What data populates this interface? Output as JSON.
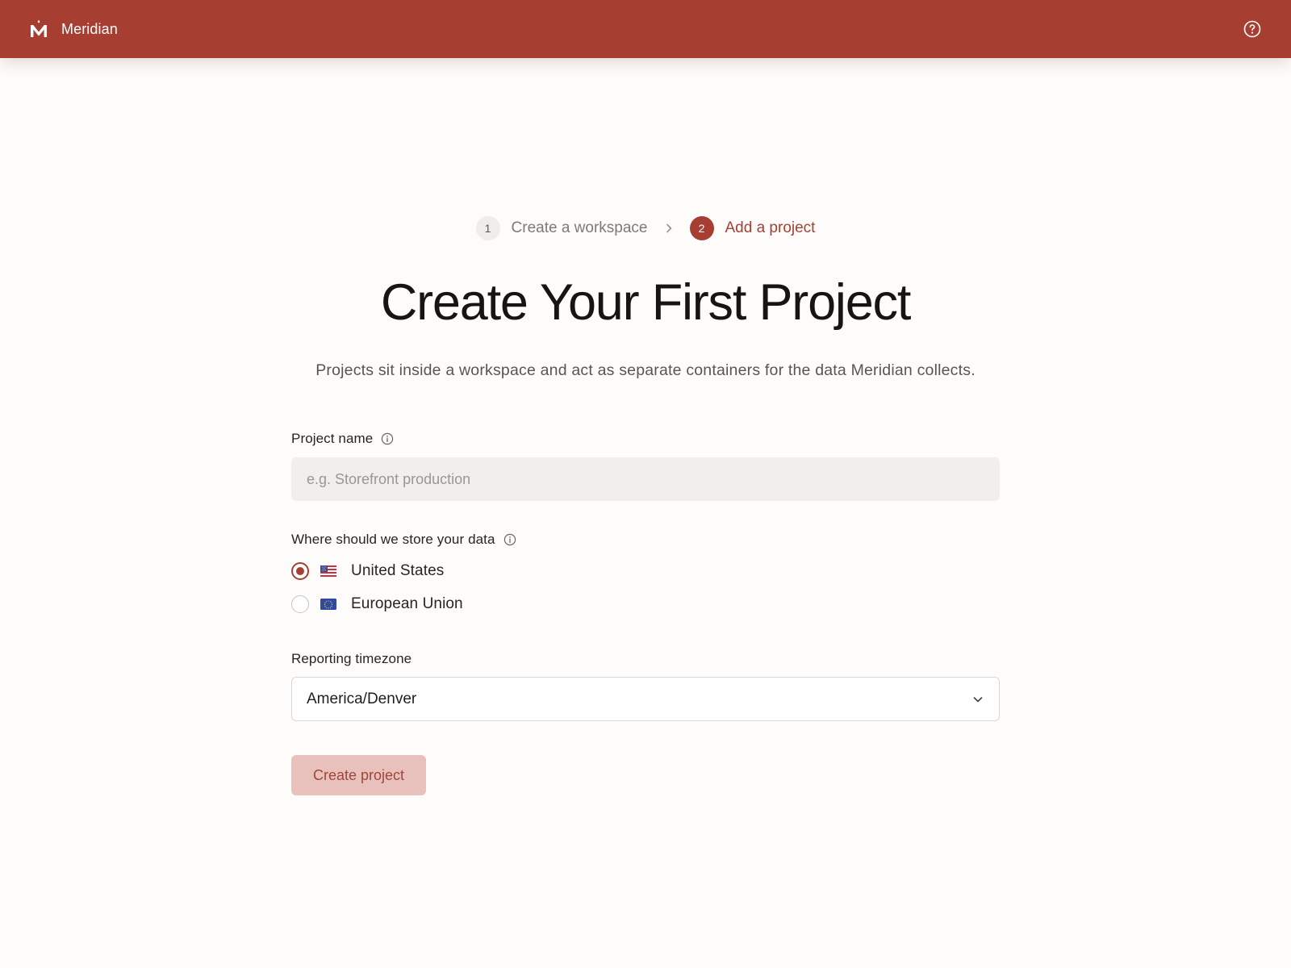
{
  "header": {
    "brand_name": "Meridian",
    "logo_icon": "meridian-logo-icon",
    "help_icon": "help-circle-icon",
    "background_color": "#a63f32"
  },
  "stepper": {
    "steps": [
      {
        "number": "1",
        "label": "Create a workspace",
        "state": "completed"
      },
      {
        "number": "2",
        "label": "Add a project",
        "state": "active"
      }
    ],
    "separator_icon": "chevron-right-icon"
  },
  "main": {
    "title": "Create Your First Project",
    "subtitle": "Projects sit inside a workspace and act as separate containers for the data Meridian collects."
  },
  "form": {
    "project_name": {
      "label": "Project name",
      "value": "",
      "placeholder": "e.g. Storefront production",
      "info_icon": "info-icon"
    },
    "data_location": {
      "label": "Where should we store your data",
      "info_icon": "info-icon",
      "selected": "United States",
      "options": [
        {
          "label": "United States",
          "flag_icon": "us-flag-icon",
          "checked": true
        },
        {
          "label": "European Union",
          "flag_icon": "eu-flag-icon",
          "checked": false
        }
      ]
    },
    "timezone": {
      "label": "Reporting timezone",
      "value": "America/Denver",
      "chevron_icon": "chevron-down-icon"
    },
    "submit": {
      "label": "Create project",
      "disabled": true
    }
  },
  "colors": {
    "accent": "#a63f32",
    "button_disabled_bg": "#e9c1bc",
    "page_background": "#fdfcfb"
  }
}
